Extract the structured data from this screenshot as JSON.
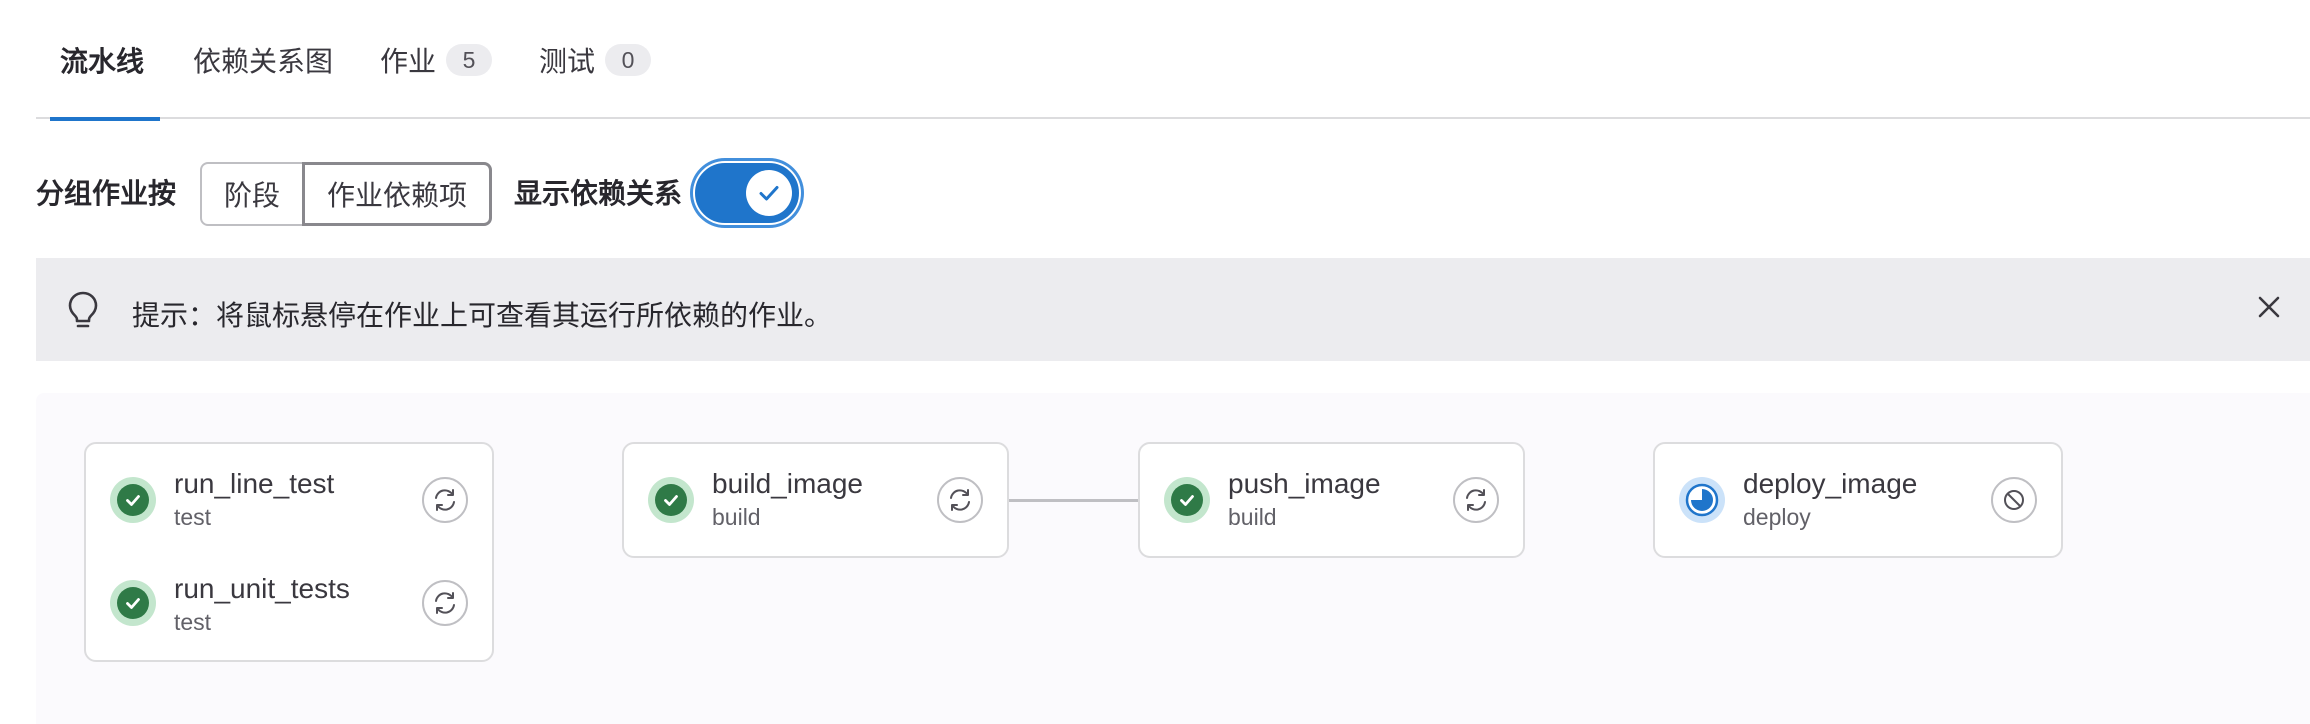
{
  "tabs": [
    {
      "label": "流水线",
      "active": true
    },
    {
      "label": "依赖关系图"
    },
    {
      "label": "作业",
      "count": "5"
    },
    {
      "label": "测试",
      "count": "0"
    }
  ],
  "controls": {
    "group_by_label": "分组作业按",
    "group_options": [
      "阶段",
      "作业依赖项"
    ],
    "selected_group": "作业依赖项",
    "show_dependencies_label": "显示依赖关系",
    "show_dependencies_on": true
  },
  "alert": {
    "text": "提示：将鼠标悬停在作业上可查看其运行所依赖的作业。",
    "icon": "bulb-icon",
    "close_icon": "close-icon"
  },
  "graph": {
    "groups": [
      {
        "jobs": [
          {
            "name": "run_line_test",
            "stage": "test",
            "status": "success",
            "action": "retry"
          },
          {
            "name": "run_unit_tests",
            "stage": "test",
            "status": "success",
            "action": "retry"
          }
        ]
      },
      {
        "jobs": [
          {
            "name": "build_image",
            "stage": "build",
            "status": "success",
            "action": "retry"
          }
        ]
      },
      {
        "jobs": [
          {
            "name": "push_image",
            "stage": "build",
            "status": "success",
            "action": "retry"
          }
        ]
      },
      {
        "jobs": [
          {
            "name": "deploy_image",
            "stage": "deploy",
            "status": "running",
            "action": "cancel"
          }
        ]
      }
    ],
    "links": [
      {
        "from": "build_image",
        "to": "push_image"
      }
    ]
  },
  "colors": {
    "accent": "#1f75cb",
    "success": "#2f7a47",
    "success_bg": "#c3e6cd",
    "running": "#1f75cb",
    "running_bg": "#cbe2f9",
    "alert_bg": "#ececef"
  }
}
